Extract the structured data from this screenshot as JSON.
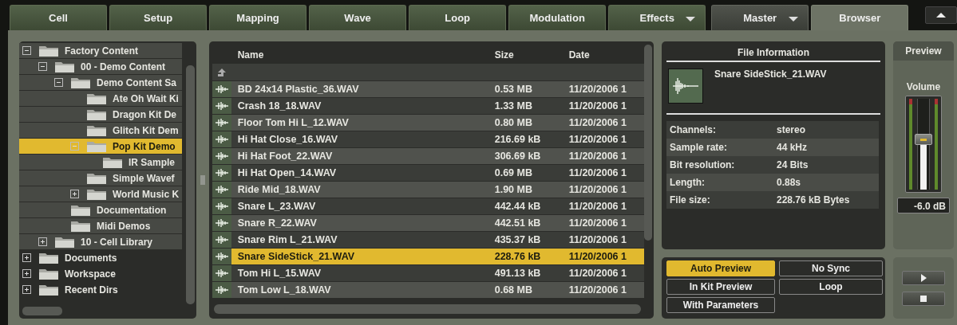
{
  "tabs": [
    {
      "label": "Cell",
      "selected": false,
      "dropdown": false,
      "kind": "page"
    },
    {
      "label": "Setup",
      "selected": false,
      "dropdown": false,
      "kind": "page"
    },
    {
      "label": "Mapping",
      "selected": false,
      "dropdown": false,
      "kind": "page"
    },
    {
      "label": "Wave",
      "selected": false,
      "dropdown": false,
      "kind": "page"
    },
    {
      "label": "Loop",
      "selected": false,
      "dropdown": false,
      "kind": "page"
    },
    {
      "label": "Modulation",
      "selected": false,
      "dropdown": false,
      "kind": "page"
    },
    {
      "label": "Effects",
      "selected": false,
      "dropdown": true,
      "kind": "page"
    },
    {
      "label": "Master",
      "selected": false,
      "dropdown": true,
      "kind": "global"
    },
    {
      "label": "Browser",
      "selected": true,
      "dropdown": false,
      "kind": "global"
    }
  ],
  "tree": [
    {
      "label": "Factory Content",
      "expanded": true,
      "selected": false,
      "children": [
        {
          "label": "00 - Demo Content",
          "expanded": true,
          "selected": false,
          "children": [
            {
              "label": "Demo Content Sa",
              "expanded": true,
              "selected": false,
              "children": [
                {
                  "label": "Ate Oh Wait Ki",
                  "selected": false
                },
                {
                  "label": "Dragon Kit De",
                  "selected": false
                },
                {
                  "label": "Glitch Kit Dem",
                  "selected": false
                },
                {
                  "label": "Pop Kit Demo",
                  "expanded": true,
                  "selected": true,
                  "children": [
                    {
                      "label": "IR Sample",
                      "selected": false
                    }
                  ]
                },
                {
                  "label": "Simple Wavef",
                  "selected": false
                },
                {
                  "label": "World Music K",
                  "expanded": false,
                  "selected": false
                }
              ]
            },
            {
              "label": "Documentation",
              "selected": false
            },
            {
              "label": "Midi Demos",
              "selected": false
            }
          ]
        },
        {
          "label": "10 - Cell Library",
          "expanded": false,
          "selected": false
        }
      ]
    },
    {
      "label": "Documents",
      "expanded": false,
      "selected": false
    },
    {
      "label": "Workspace",
      "expanded": false,
      "selected": false
    },
    {
      "label": "Recent Dirs",
      "expanded": false,
      "selected": false
    }
  ],
  "file_list": {
    "columns": [
      "Name",
      "Size",
      "Date"
    ],
    "rows": [
      {
        "name": "BD 24x14 Plastic_36.WAV",
        "size": "0.53 MB",
        "date": "11/20/2006 1",
        "selected": false
      },
      {
        "name": "Crash 18_18.WAV",
        "size": "1.33 MB",
        "date": "11/20/2006 1",
        "selected": false
      },
      {
        "name": "Floor Tom Hi L_12.WAV",
        "size": "0.80 MB",
        "date": "11/20/2006 1",
        "selected": false
      },
      {
        "name": "Hi Hat Close_16.WAV",
        "size": "216.69 kB",
        "date": "11/20/2006 1",
        "selected": false
      },
      {
        "name": "Hi Hat Foot_22.WAV",
        "size": "306.69 kB",
        "date": "11/20/2006 1",
        "selected": false
      },
      {
        "name": "Hi Hat Open_14.WAV",
        "size": "0.69 MB",
        "date": "11/20/2006 1",
        "selected": false
      },
      {
        "name": "Ride Mid_18.WAV",
        "size": "1.90 MB",
        "date": "11/20/2006 1",
        "selected": false
      },
      {
        "name": "Snare L_23.WAV",
        "size": "442.44 kB",
        "date": "11/20/2006 1",
        "selected": false
      },
      {
        "name": "Snare R_22.WAV",
        "size": "442.51 kB",
        "date": "11/20/2006 1",
        "selected": false
      },
      {
        "name": "Snare Rim L_21.WAV",
        "size": "435.37 kB",
        "date": "11/20/2006 1",
        "selected": false
      },
      {
        "name": "Snare SideStick_21.WAV",
        "size": "228.76 kB",
        "date": "11/20/2006 1",
        "selected": true
      },
      {
        "name": "Tom Hi L_15.WAV",
        "size": "491.13 kB",
        "date": "11/20/2006 1",
        "selected": false
      },
      {
        "name": "Tom Low L_18.WAV",
        "size": "0.68 MB",
        "date": "11/20/2006 1",
        "selected": false
      }
    ]
  },
  "file_info": {
    "title": "File Information",
    "file_name": "Snare SideStick_21.WAV",
    "properties": [
      {
        "label": "Channels:",
        "value": "stereo"
      },
      {
        "label": "Sample rate:",
        "value": "44 kHz"
      },
      {
        "label": "Bit resolution:",
        "value": "24 Bits"
      },
      {
        "label": "Length:",
        "value": "0.88s"
      },
      {
        "label": "File size:",
        "value": "228.76 kB Bytes"
      }
    ]
  },
  "preview": {
    "title": "Preview",
    "volume": {
      "label": "Volume",
      "level": 0.55,
      "reading": "-6.0 dB"
    }
  },
  "options": [
    {
      "label": "Auto Preview",
      "on": true
    },
    {
      "label": "No Sync",
      "on": false
    },
    {
      "label": "In Kit Preview",
      "on": false
    },
    {
      "label": "Loop",
      "on": false
    },
    {
      "label": "With Parameters",
      "on": false
    }
  ]
}
